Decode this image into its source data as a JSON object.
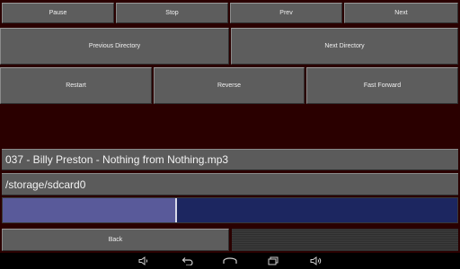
{
  "controls": {
    "pause": "Pause",
    "stop": "Stop",
    "prev": "Prev",
    "next": "Next",
    "previous_directory": "Previous Directory",
    "next_directory": "Next Directory",
    "restart": "Restart",
    "reverse": "Reverse",
    "fast_forward": "Fast Forward"
  },
  "now_playing": {
    "track": "037 - Billy Preston - Nothing from Nothing.mp3",
    "directory": "/storage/sdcard0"
  },
  "playback": {
    "progress_fraction": 0.38
  },
  "footer": {
    "back": "Back"
  },
  "nav_icons": [
    "volume-down-icon",
    "back-icon",
    "home-icon",
    "recent-apps-icon",
    "volume-up-icon"
  ],
  "colors": {
    "background": "#2a0000",
    "button": "#5d5d5d",
    "progress_track": "#1c2660",
    "progress_fill": "#595a9a"
  }
}
